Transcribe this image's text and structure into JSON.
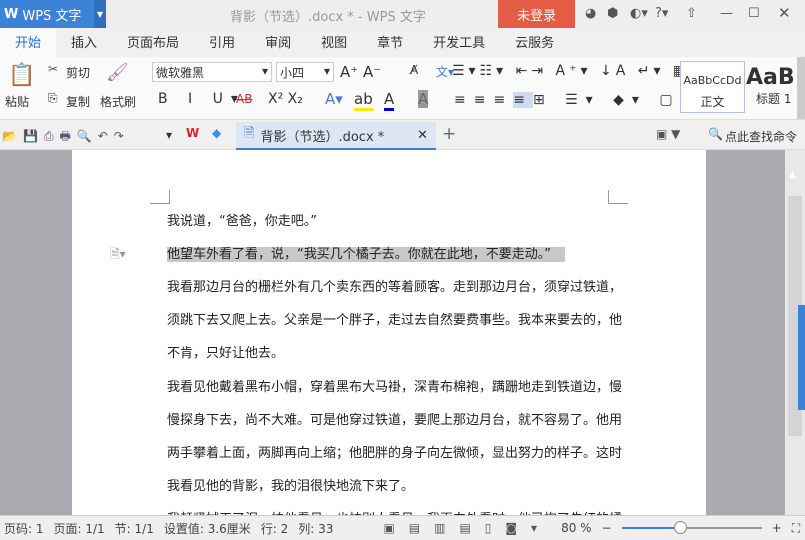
{
  "app": {
    "name": "WPS 文字",
    "title": "背影（节选）.docx * - WPS 文字",
    "login": "未登录"
  },
  "tabs": [
    "开始",
    "插入",
    "页面布局",
    "引用",
    "审阅",
    "视图",
    "章节",
    "开发工具",
    "云服务"
  ],
  "ribbon": {
    "paste": "粘贴",
    "cut": "剪切",
    "copy": "复制",
    "format_painter": "格式刷",
    "font": "微软雅黑",
    "size": "小四",
    "styles": [
      {
        "preview": "AaBbCcDd",
        "label": "正文"
      },
      {
        "preview": "AaB",
        "label": "标题 1"
      }
    ]
  },
  "doc_tab": "背影（节选）.docx *",
  "search": "点此查找命令",
  "lines": [
    "我说道，“爸爸，你走吧。”",
    "他望车外看了看，说，“我买几个橘子去。你就在此地，不要走动。”",
    "我看那边月台的栅栏外有几个卖东西的等着顾客。走到那边月台，须穿过铁道，",
    "须跳下去又爬上去。父亲是一个胖子，走过去自然要费事些。我本来要去的，他",
    "不肯，只好让他去。",
    "我看见他戴着黑布小帽，穿着黑布大马褂，深青布棉袍，蹒跚地走到铁道边，慢",
    "慢探身下去，尚不大难。可是他穿过铁道，要爬上那边月台，就不容易了。他用",
    "两手攀着上面，两脚再向上缩；他肥胖的身子向左微倾，显出努力的样子。这时",
    "我看见他的背影，我的泪很快地流下来了。",
    "我赶紧拭干了泪，怕他看见，也怕别人看见。我再向外看时，他已抱了朱红的橘"
  ],
  "status": {
    "page_code": "页码: 1",
    "page": "页面: 1/1",
    "section": "节: 1/1",
    "setting": "设置值: 3.6厘米",
    "row": "行: 2",
    "col": "列: 33",
    "zoom": "80 %"
  },
  "zoom_level": 80
}
